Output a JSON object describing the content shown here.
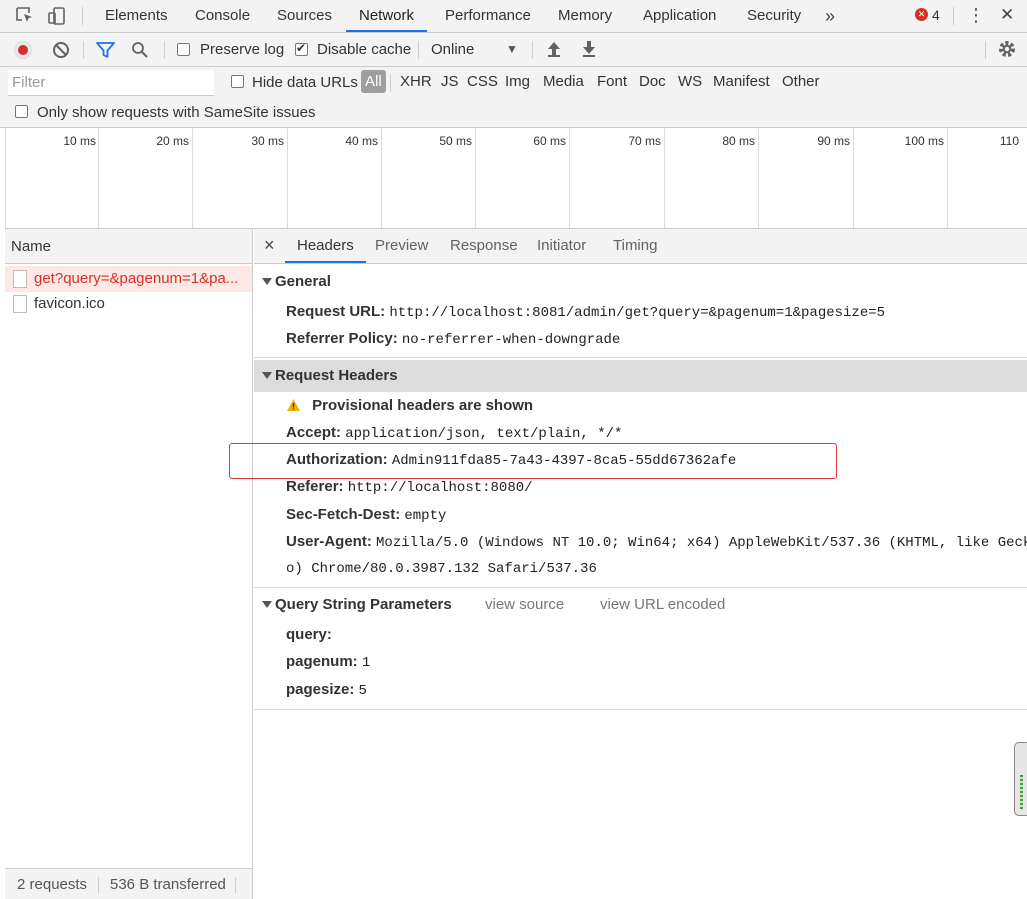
{
  "tabbar": {
    "tabs": [
      "Elements",
      "Console",
      "Sources",
      "Network",
      "Performance",
      "Memory",
      "Application",
      "Security"
    ],
    "active_tab": "Network",
    "more": "»",
    "error_count": "4",
    "menu_glyph": "⋮",
    "close_glyph": "✕"
  },
  "toolbar": {
    "preserve_log": "Preserve log",
    "disable_cache": "Disable cache",
    "throttling": "Online",
    "dropdown_glyph": "▼"
  },
  "filterbar": {
    "placeholder": "Filter",
    "hide_data_urls": "Hide data URLs",
    "types": [
      "All",
      "XHR",
      "JS",
      "CSS",
      "Img",
      "Media",
      "Font",
      "Doc",
      "WS",
      "Manifest",
      "Other"
    ],
    "samesite": "Only show requests with SameSite issues"
  },
  "timeline": {
    "ticks": [
      "10 ms",
      "20 ms",
      "30 ms",
      "40 ms",
      "50 ms",
      "60 ms",
      "70 ms",
      "80 ms",
      "90 ms",
      "100 ms",
      "110"
    ]
  },
  "requests": {
    "header": "Name",
    "items": [
      "get?query=&pagenum=1&pa...",
      "favicon.ico"
    ],
    "summary": "2 requests",
    "transferred": "536 B transferred"
  },
  "detail": {
    "close_glyph": "×",
    "tabs": [
      "Headers",
      "Preview",
      "Response",
      "Initiator",
      "Timing"
    ],
    "general": {
      "title": "General",
      "request_url_key": "Request URL:",
      "request_url_val": "http://localhost:8081/admin/get?query=&pagenum=1&pagesize=5",
      "referrer_policy_key": "Referrer Policy:",
      "referrer_policy_val": "no-referrer-when-downgrade"
    },
    "request_headers": {
      "title": "Request Headers",
      "warning": "Provisional headers are shown",
      "accept_key": "Accept:",
      "accept_val": "application/json, text/plain, */*",
      "auth_key": "Authorization:",
      "auth_val": "Admin911fda85-7a43-4397-8ca5-55dd67362afe",
      "referer_key": "Referer:",
      "referer_val": "http://localhost:8080/",
      "sec_key": "Sec-Fetch-Dest:",
      "sec_val": "empty",
      "ua_key": "User-Agent:",
      "ua_val_1": "Mozilla/5.0 (Windows NT 10.0; Win64; x64) AppleWebKit/537.36 (KHTML, like Geck",
      "ua_val_2": "o) Chrome/80.0.3987.132 Safari/537.36"
    },
    "query_params": {
      "title": "Query String Parameters",
      "view_source": "view source",
      "view_url_encoded": "view URL encoded",
      "query_key": "query:",
      "query_val": "",
      "pagenum_key": "pagenum:",
      "pagenum_val": "1",
      "pagesize_key": "pagesize:",
      "pagesize_val": "5"
    }
  },
  "colors": {
    "accent": "#1a73e8",
    "record": "#d93025",
    "error_request": "#d93025",
    "highlight_box": "#e0383c"
  }
}
